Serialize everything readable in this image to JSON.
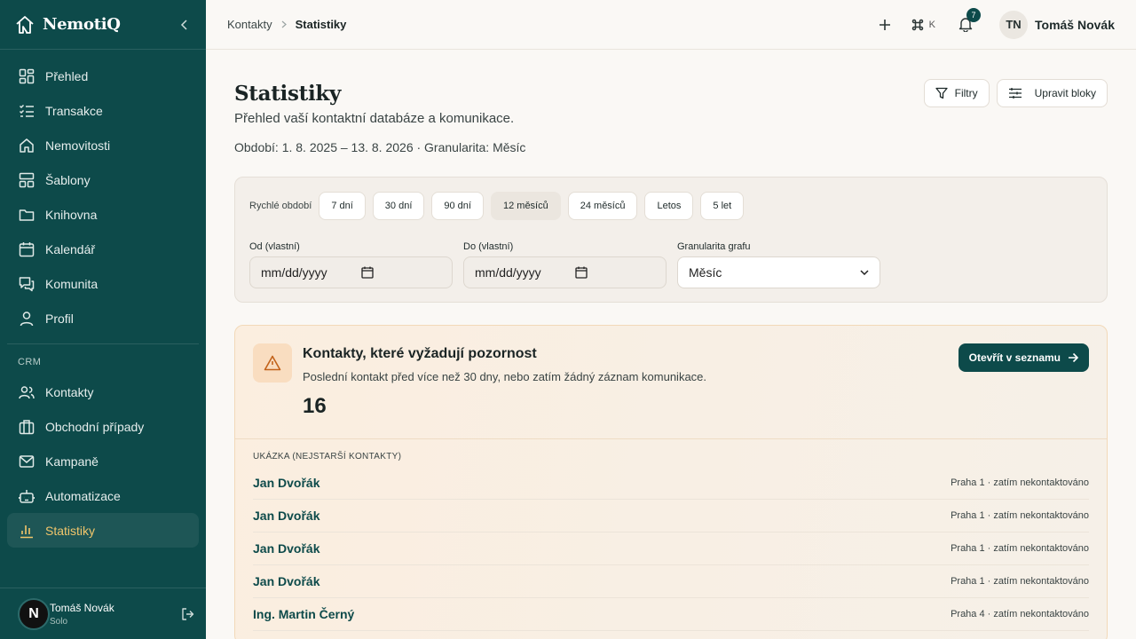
{
  "brand": {
    "name": "NemotiQ"
  },
  "sidebar": {
    "items": [
      {
        "label": "Přehled",
        "icon": "grid-icon"
      },
      {
        "label": "Transakce",
        "icon": "checklist-icon"
      },
      {
        "label": "Nemovitosti",
        "icon": "home-icon"
      },
      {
        "label": "Šablony",
        "icon": "layout-icon"
      },
      {
        "label": "Knihovna",
        "icon": "folder-icon"
      },
      {
        "label": "Kalendář",
        "icon": "calendar-icon"
      },
      {
        "label": "Komunita",
        "icon": "chat-icon"
      },
      {
        "label": "Profil",
        "icon": "user-icon"
      }
    ],
    "section": "CRM",
    "crm_items": [
      {
        "label": "Kontakty",
        "icon": "users-icon"
      },
      {
        "label": "Obchodní případy",
        "icon": "briefcase-icon"
      },
      {
        "label": "Kampaně",
        "icon": "mail-icon"
      },
      {
        "label": "Automatizace",
        "icon": "robot-icon"
      },
      {
        "label": "Statistiky",
        "icon": "bar-chart-icon",
        "active": true
      }
    ],
    "footer": {
      "avatar": "N",
      "name": "Tomáš Novák",
      "plan": "Solo"
    }
  },
  "topbar": {
    "breadcrumb": [
      "Kontakty",
      "Statistiky"
    ],
    "shortcut_key": "K",
    "notifications": "7",
    "user_initials": "TN",
    "user_name": "Tomáš Novák"
  },
  "page": {
    "title": "Statistiky",
    "subtitle": "Přehled vaší kontaktní databáze a komunikace.",
    "period": "Období: 1. 8. 2025 – 13. 8. 2026 · Granularita: Měsíc",
    "filters_btn": "Filtry",
    "edit_blocks_btn": "Upravit bloky"
  },
  "filters": {
    "quick_label": "Rychlé období",
    "chips": [
      "7 dní",
      "30 dní",
      "90 dní",
      "12 měsíců",
      "24 měsíců",
      "Letos",
      "5 let"
    ],
    "active_chip": "12 měsíců",
    "from_label": "Od (vlastní)",
    "to_label": "Do (vlastní)",
    "date_placeholder": "mm/dd/yyyy",
    "granularity_label": "Granularita grafu",
    "granularity_value": "Měsíc"
  },
  "attention": {
    "title": "Kontakty, které vyžadují pozornost",
    "subtitle": "Poslední kontakt před více než 30 dny, nebo zatím žádný záznam komunikace.",
    "count": "16",
    "open_btn": "Otevřít v seznamu",
    "list_header": "UKÁZKA (NEJSTARŠÍ KONTAKTY)",
    "rows": [
      {
        "name": "Jan Dvořák",
        "meta": "Praha 1 · zatím nekontaktováno"
      },
      {
        "name": "Jan Dvořák",
        "meta": "Praha 1 · zatím nekontaktováno"
      },
      {
        "name": "Jan Dvořák",
        "meta": "Praha 1 · zatím nekontaktováno"
      },
      {
        "name": "Jan Dvořák",
        "meta": "Praha 1 · zatím nekontaktováno"
      },
      {
        "name": "Ing. Martin Černý",
        "meta": "Praha 4 · zatím nekontaktováno"
      }
    ]
  },
  "colors": {
    "sidebar": "#0d4a4a",
    "accent": "#f0c56b",
    "warning": "#c2621a"
  }
}
